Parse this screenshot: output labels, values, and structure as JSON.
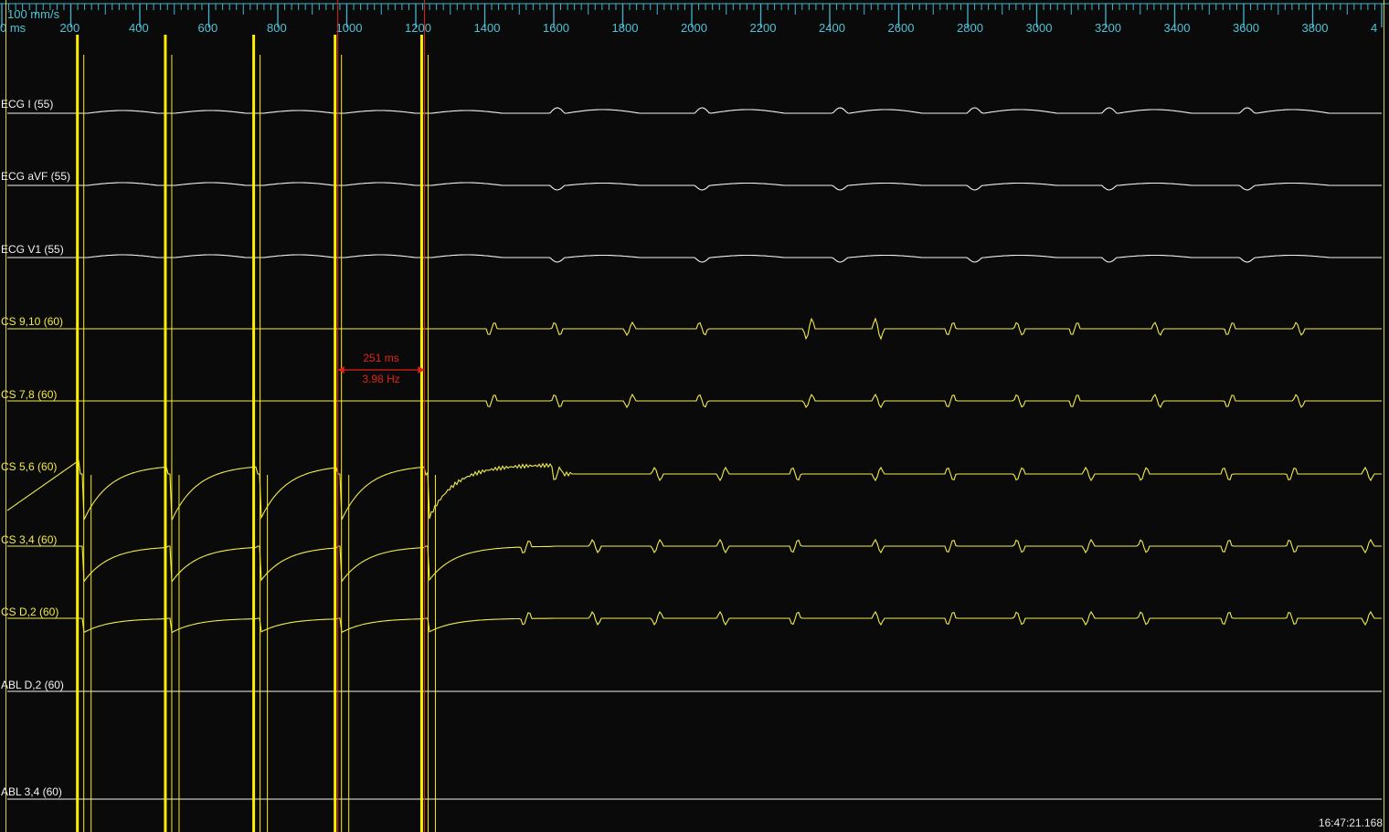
{
  "window": {
    "sweep_speed_label": "100 mm/s",
    "clock": "16:47:21.168"
  },
  "colors": {
    "background": "#0a0a0a",
    "ruler": "#3fb6cf",
    "surface_ecg": "#f2f2f2",
    "intracardiac": "#f2ec4a",
    "pacing": "#ffee00",
    "caliper": "#e2231a"
  },
  "caliper": {
    "interval_label": "251 ms",
    "rate_label": "3.98 Hz",
    "start_ms": 974,
    "end_ms": 1225
  },
  "chart_data": {
    "type": "line",
    "title": "",
    "xlabel": "",
    "ylabel": "",
    "x_unit": "ms",
    "xlim": [
      0,
      4000
    ],
    "x_ticks": [
      {
        "value": 0,
        "label": "0 ms"
      },
      {
        "value": 200,
        "label": "200"
      },
      {
        "value": 400,
        "label": "400"
      },
      {
        "value": 600,
        "label": "600"
      },
      {
        "value": 800,
        "label": "800"
      },
      {
        "value": 1000,
        "label": "1000"
      },
      {
        "value": 1200,
        "label": "1200"
      },
      {
        "value": 1400,
        "label": "1400"
      },
      {
        "value": 1600,
        "label": "1600"
      },
      {
        "value": 1800,
        "label": "1800"
      },
      {
        "value": 2000,
        "label": "2000"
      },
      {
        "value": 2200,
        "label": "2200"
      },
      {
        "value": 2400,
        "label": "2400"
      },
      {
        "value": 2600,
        "label": "2600"
      },
      {
        "value": 2800,
        "label": "2800"
      },
      {
        "value": 3000,
        "label": "3000"
      },
      {
        "value": 3200,
        "label": "3200"
      },
      {
        "value": 3400,
        "label": "3400"
      },
      {
        "value": 3600,
        "label": "3600"
      },
      {
        "value": 3800,
        "label": "3800"
      },
      {
        "value": 4000,
        "label": "4"
      }
    ],
    "grid": false,
    "pacing_spikes_ms": [
      227,
      482,
      738,
      974,
      1225
    ],
    "series": [
      {
        "name": "ECG I (55)",
        "kind": "surface",
        "beats_ms": [
          1610,
          2030,
          2430,
          2820,
          3210,
          3610
        ]
      },
      {
        "name": "ECG aVF (55)",
        "kind": "surface",
        "beats_ms": [
          1610,
          2030,
          2430,
          2820,
          3210,
          3610
        ]
      },
      {
        "name": "ECG V1 (55)",
        "kind": "surface",
        "beats_ms": [
          1610,
          2030,
          2430,
          2820,
          3210,
          3610
        ]
      },
      {
        "name": "CS 9,10 (60)",
        "kind": "intracardiac",
        "beats_ms": [
          1420,
          1610,
          1820,
          2030,
          2340,
          2540,
          2750,
          2950,
          3110,
          3350,
          3560,
          3760
        ]
      },
      {
        "name": "CS 7,8 (60)",
        "kind": "intracardiac",
        "beats_ms": [
          1420,
          1610,
          1820,
          2030,
          2340,
          2540,
          2750,
          2950,
          3110,
          3350,
          3560,
          3760
        ]
      },
      {
        "name": "CS 5,6 (60)",
        "kind": "intracardiac",
        "beats_ms": [
          1610,
          1900,
          2090,
          2300,
          2540,
          2750,
          2950,
          3150,
          3310,
          3550,
          3740,
          3960
        ]
      },
      {
        "name": "CS 3,4 (60)",
        "kind": "intracardiac",
        "beats_ms": [
          1520,
          1720,
          1900,
          2090,
          2300,
          2540,
          2750,
          2950,
          3150,
          3310,
          3550,
          3740,
          3960
        ]
      },
      {
        "name": "CS D,2 (60)",
        "kind": "intracardiac",
        "beats_ms": [
          1520,
          1720,
          1900,
          2090,
          2300,
          2540,
          2750,
          2950,
          3150,
          3310,
          3550,
          3740,
          3960
        ]
      },
      {
        "name": "ABL D,2 (60)",
        "kind": "flat",
        "beats_ms": []
      },
      {
        "name": "ABL 3,4 (60)",
        "kind": "flat",
        "beats_ms": []
      }
    ]
  }
}
